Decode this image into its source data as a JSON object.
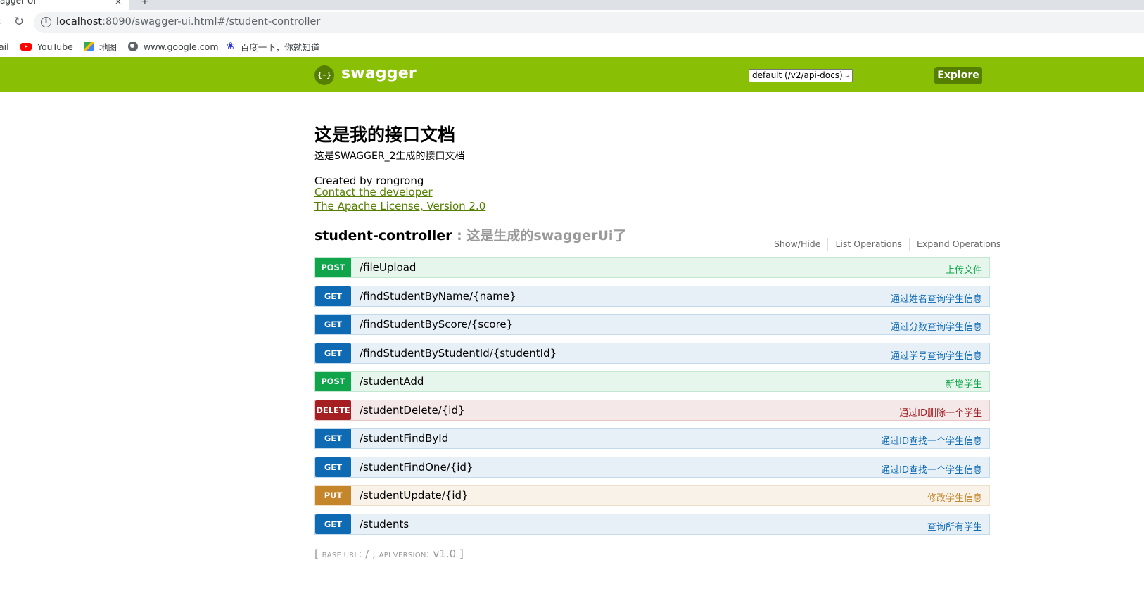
{
  "browser": {
    "tab_title": "agger UI",
    "tab_close": "×",
    "new_tab": "+",
    "url_host": "localhost",
    "url_rest": ":8090/swagger-ui.html#/student-controller",
    "bookmarks": [
      {
        "label": "ail",
        "icon": "none"
      },
      {
        "label": "YouTube",
        "icon": "youtube-icon"
      },
      {
        "label": "地图",
        "icon": "maps-icon"
      },
      {
        "label": "www.google.com",
        "icon": "globe-icon"
      },
      {
        "label": "百度一下，你就知道",
        "icon": "baidu-icon"
      }
    ]
  },
  "header": {
    "logo_glyph": "{-}",
    "logo_text": "swagger",
    "api_select_value": "default (/v2/api-docs)",
    "explore_label": "Explore",
    "brand_color": "#89bf04"
  },
  "info": {
    "title": "这是我的接口文档",
    "description": "这是SWAGGER_2生成的接口文档",
    "created_by": "Created by rongrong",
    "contact_link": "Contact the developer",
    "license_link": "The Apache License, Version 2.0"
  },
  "resource": {
    "name": "student-controller",
    "separator": " : ",
    "description": "这是生成的swaggerUi了",
    "links": [
      "Show/Hide",
      "List Operations",
      "Expand Operations"
    ]
  },
  "operations": [
    {
      "method": "POST",
      "path": "/fileUpload",
      "summary": "上传文件"
    },
    {
      "method": "GET",
      "path": "/findStudentByName/{name}",
      "summary": "通过姓名查询学生信息"
    },
    {
      "method": "GET",
      "path": "/findStudentByScore/{score}",
      "summary": "通过分数查询学生信息"
    },
    {
      "method": "GET",
      "path": "/findStudentByStudentId/{studentId}",
      "summary": "通过学号查询学生信息"
    },
    {
      "method": "POST",
      "path": "/studentAdd",
      "summary": "新增学生"
    },
    {
      "method": "DELETE",
      "path": "/studentDelete/{id}",
      "summary": "通过ID删除一个学生"
    },
    {
      "method": "GET",
      "path": "/studentFindById",
      "summary": "通过ID查找一个学生信息"
    },
    {
      "method": "GET",
      "path": "/studentFindOne/{id}",
      "summary": "通过ID查找一个学生信息"
    },
    {
      "method": "PUT",
      "path": "/studentUpdate/{id}",
      "summary": "修改学生信息"
    },
    {
      "method": "GET",
      "path": "/students",
      "summary": "查询所有学生"
    }
  ],
  "footer": {
    "open": "[ ",
    "base_url_label": "BASE URL",
    "base_url_value": ": / , ",
    "api_version_label": "API VERSION",
    "api_version_value": ": v1.0 ]"
  }
}
